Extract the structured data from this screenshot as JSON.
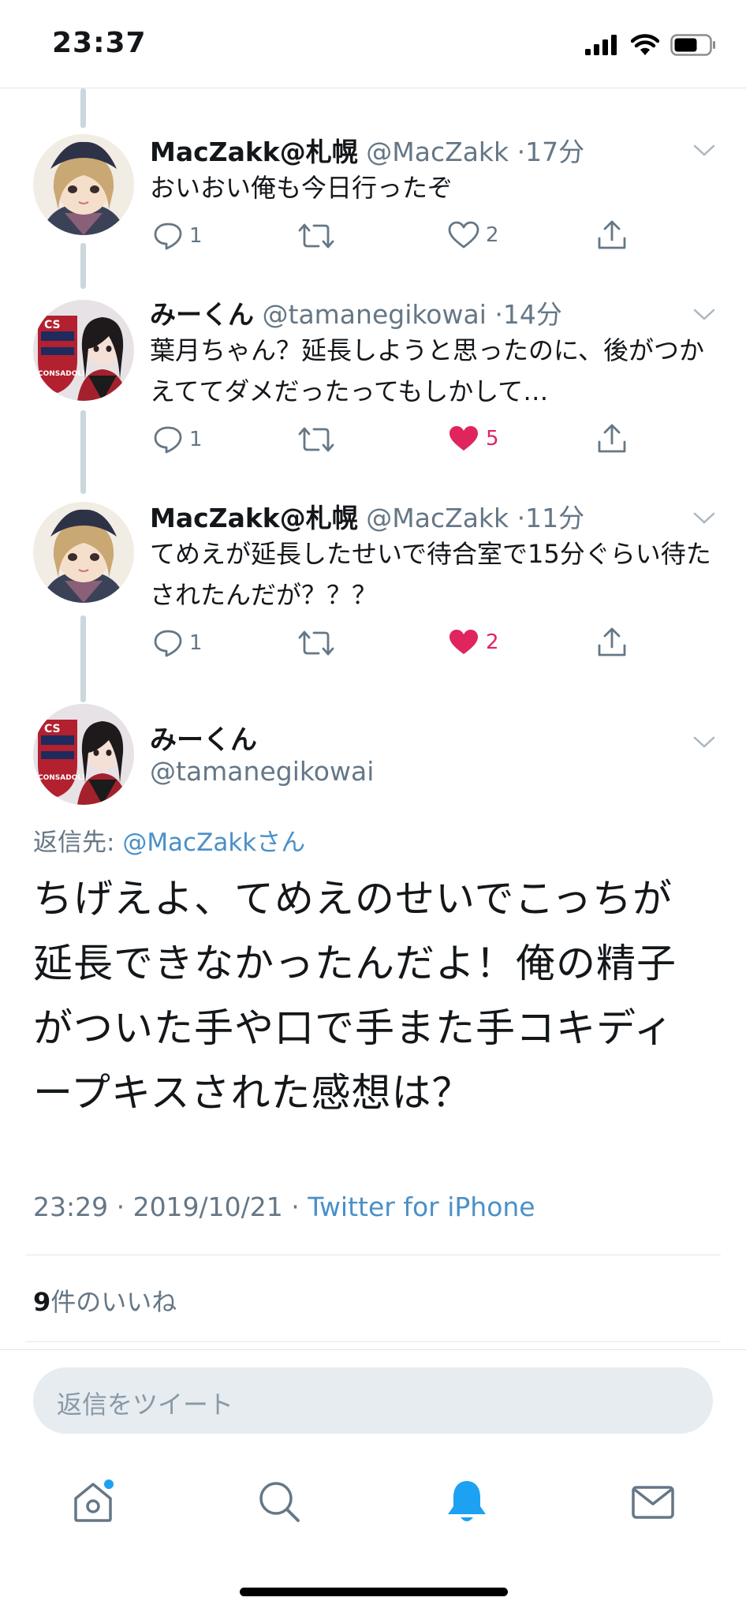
{
  "status_bar": {
    "time": "23:37"
  },
  "tweets": [
    {
      "name": "MacZakk@札幌",
      "handle": "@MacZakk",
      "time": "17分",
      "text": "おいおい俺も今日行ったぞ",
      "replies": "1",
      "retweets": "",
      "likes": "2",
      "liked": false
    },
    {
      "name": "みーくん",
      "handle": "@tamanegikowai",
      "time": "14分",
      "text": "葉月ちゃん？延長しようと思ったのに、後がつかえててダメだったってもしかして…",
      "replies": "1",
      "retweets": "",
      "likes": "5",
      "liked": true
    },
    {
      "name": "MacZakk@札幌",
      "handle": "@MacZakk",
      "time": "11分",
      "text": "てめえが延長したせいで待合室で15分ぐらい待たされたんだが？？？",
      "replies": "1",
      "retweets": "",
      "likes": "2",
      "liked": true
    }
  ],
  "main_tweet": {
    "name": "みーくん",
    "handle": "@tamanegikowai",
    "reply_to_label": "返信先:",
    "reply_to_mention": "@MacZakkさん",
    "text": "ちげえよ、てめえのせいでこっちが延長できなかったんだよ！俺の精子がついた手や口で手また手コキディープキスされた感想は？",
    "timestamp": "23:29 · 2019/10/21 · ",
    "source": "Twitter for iPhone",
    "likes_count": "9",
    "likes_label": "件のいいね"
  },
  "reply_input": {
    "placeholder": "返信をツイート"
  },
  "tab_bar": {
    "items": [
      "home-icon",
      "search-icon",
      "notifications-icon",
      "messages-icon"
    ],
    "active": "notifications-icon"
  },
  "colors": {
    "like": "#e0245e",
    "link": "#4a90c8",
    "secondary_text": "#657786",
    "thread_line": "#ccd6dd",
    "active_tab": "#1da1f2"
  }
}
